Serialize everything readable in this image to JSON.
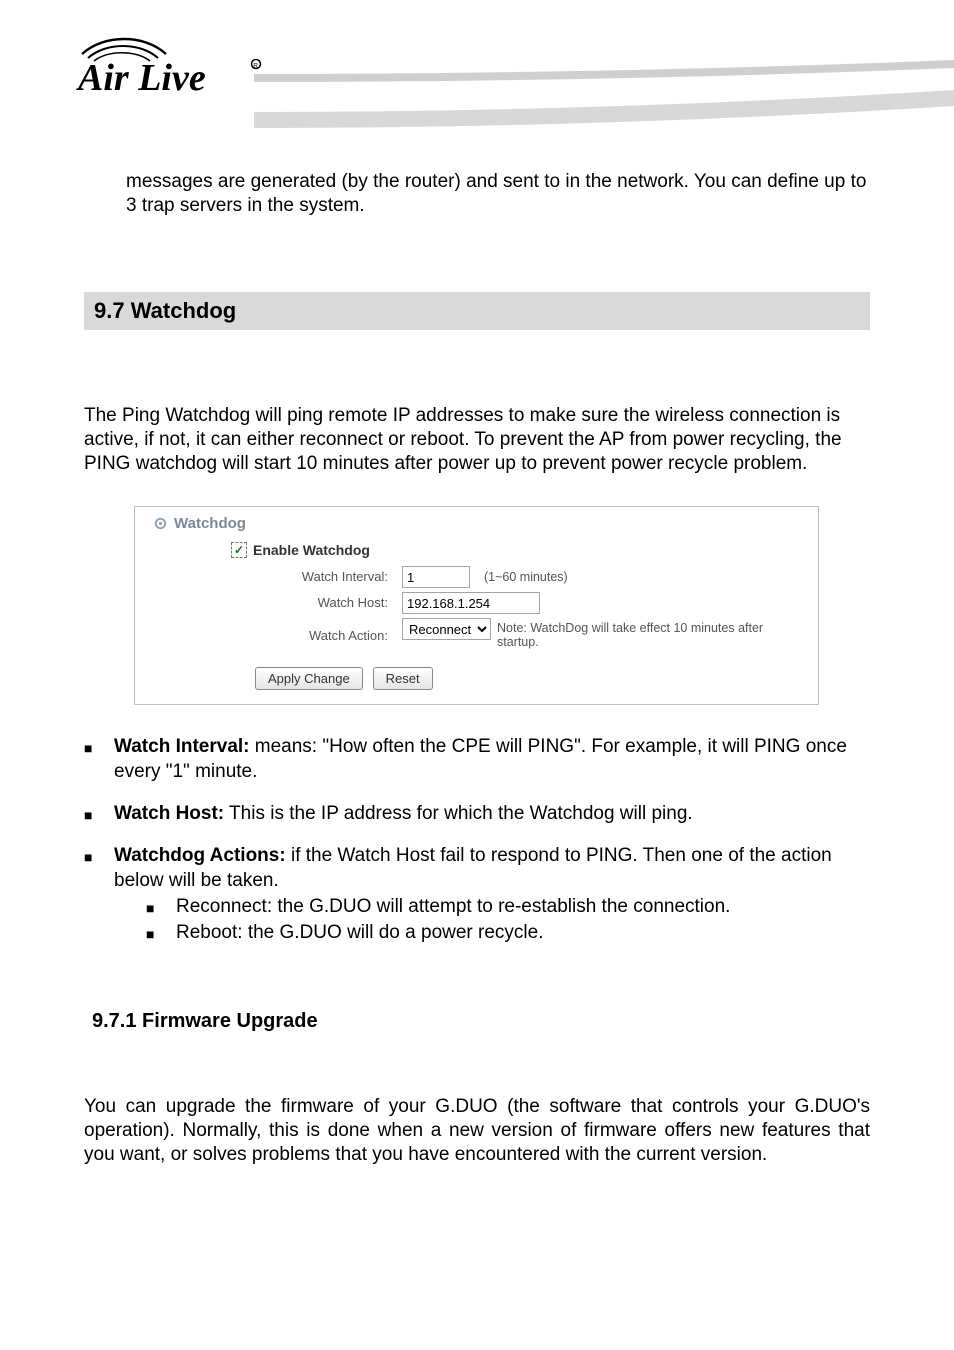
{
  "header": {
    "logo_alt": "AirLive"
  },
  "intro": "messages are generated (by the router) and sent to in the network.    You can define up to 3 trap servers in the system.",
  "section": {
    "title": "9.7 Watchdog",
    "intro": "The Ping Watchdog will ping remote IP addresses to make sure the wireless connection is active, if not, it can either reconnect or reboot.      To prevent the AP from power recycling, the PING watchdog will start 10 minutes after power up to prevent power recycle problem."
  },
  "panel": {
    "title": "Watchdog",
    "enable_label": "Enable Watchdog",
    "interval_label": "Watch Interval:",
    "interval_value": "1",
    "interval_hint": "(1~60 minutes)",
    "host_label": "Watch Host:",
    "host_value": "192.168.1.254",
    "action_label": "Watch Action:",
    "action_value": "Reconnect",
    "action_note": "Note: WatchDog will take effect 10 minutes after startup.",
    "apply_btn": "Apply Change",
    "reset_btn": "Reset"
  },
  "bullets": {
    "b1_label": "Watch Interval:",
    "b1_text": "   means: \"How often the CPE will PING\".   For example, it will PING once every \"1\" minute.",
    "b2_label": "Watch Host:",
    "b2_text": " This is the IP address for which the Watchdog will ping.",
    "b3_label": "Watchdog Actions:",
    "b3_text": " if the Watch Host fail to respond to PING.    Then one of the action below will be taken.",
    "b3_sub1": "Reconnect: the G.DUO will attempt to re-establish the connection.",
    "b3_sub2": "Reboot:   the G.DUO will do a power recycle."
  },
  "subsection": {
    "title": "9.7.1 Firmware Upgrade",
    "para": "You can upgrade the firmware of your G.DUO (the software that controls your G.DUO's operation). Normally, this is done when a new version of firmware offers new features that you want, or solves problems that you have encountered with the current version."
  }
}
